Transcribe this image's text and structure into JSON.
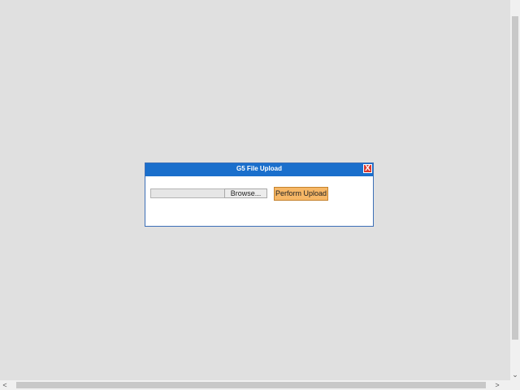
{
  "dialog": {
    "title": "G5 File Upload",
    "close_icon": "close-icon",
    "close_glyph": "X",
    "browse_label": "Browse...",
    "upload_label": "Perform Upload",
    "file_path_value": ""
  },
  "scrollbars": {
    "down_arrow": "⌄",
    "left_arrow": "<",
    "right_arrow": ">"
  },
  "colors": {
    "titlebar": "#1a6fcc",
    "upload_button": "#f6b766",
    "close_button": "#d93a2f",
    "background": "#e0e0e0"
  }
}
